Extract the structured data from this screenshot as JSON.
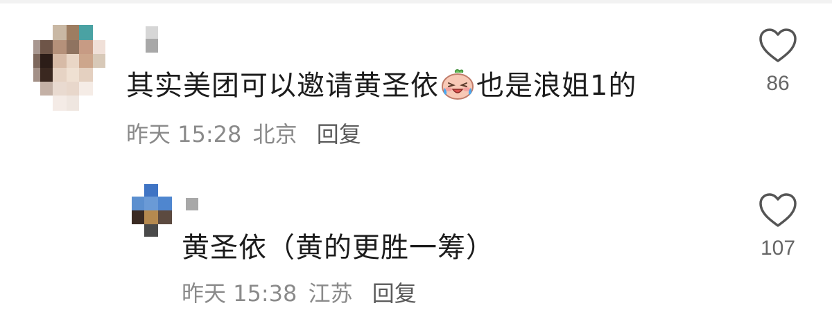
{
  "comments": [
    {
      "text_before_emoji": "其实美团可以邀请黄圣依",
      "emoji": "crying-laughing-peach-emoji",
      "text_after_emoji": "也是浪姐1的",
      "time": "昨天 15:28",
      "location": "北京",
      "reply_label": "回复",
      "like_count": "86",
      "icon": "heart-outline-icon"
    },
    {
      "text": "黄圣依（黄的更胜一筹）",
      "time": "昨天 15:38",
      "location": "江苏",
      "reply_label": "回复",
      "like_count": "107",
      "icon": "heart-outline-icon"
    }
  ],
  "colors": {
    "text_primary": "#1c1c1c",
    "text_secondary": "#8a8a8a",
    "reply_link": "#5a5a5a",
    "heart_stroke": "#555555"
  }
}
